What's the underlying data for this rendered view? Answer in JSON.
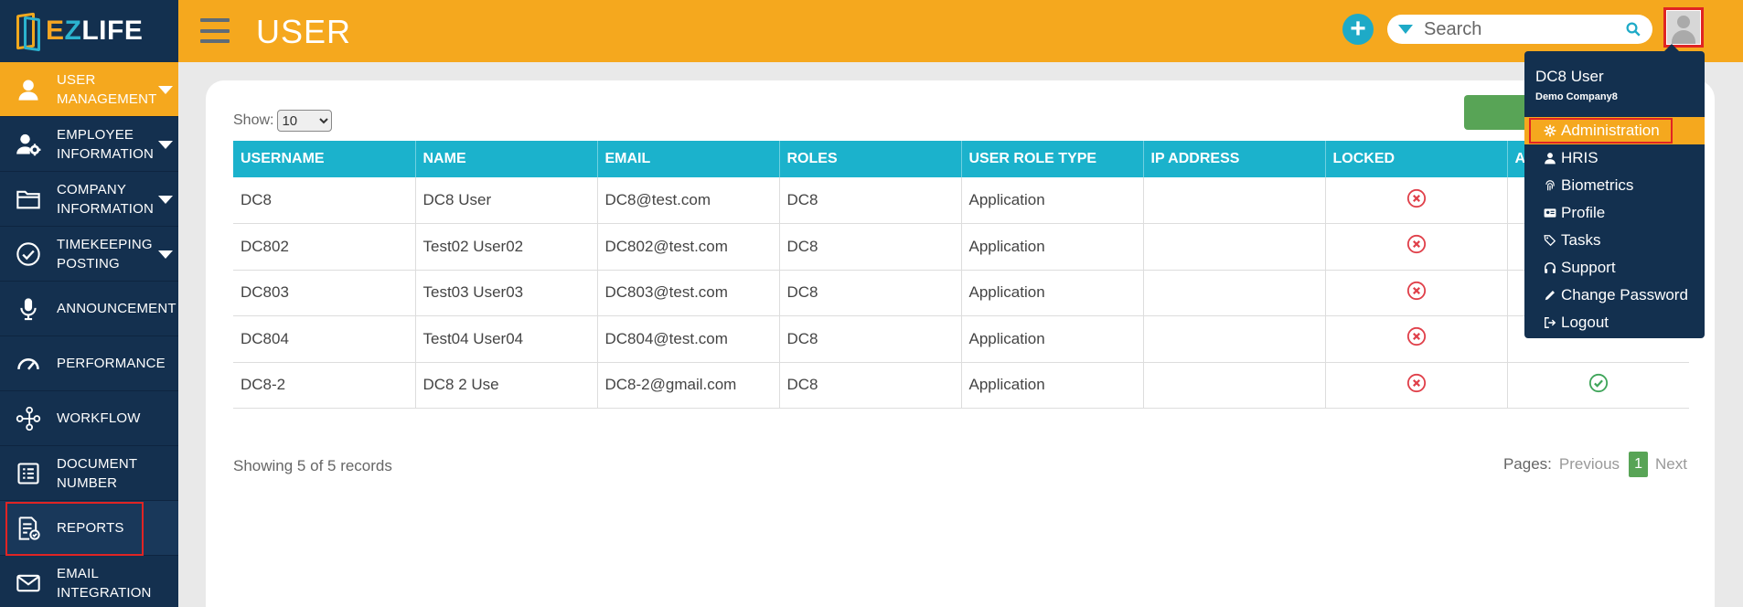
{
  "logo": {
    "letter_e": "E",
    "letter_z": "Z",
    "rest": "LIFE"
  },
  "sidebar": {
    "items": [
      {
        "label": "USER MANAGEMENT",
        "icon": "user-icon",
        "active": true,
        "caret": true
      },
      {
        "label": "EMPLOYEE INFORMATION",
        "icon": "user-gear-icon",
        "caret": true
      },
      {
        "label": "COMPANY INFORMATION",
        "icon": "folder-icon",
        "caret": true
      },
      {
        "label": "TIMEKEEPING POSTING",
        "icon": "check-circle-icon",
        "caret": true
      },
      {
        "label": "ANNOUNCEMENT",
        "icon": "microphone-icon"
      },
      {
        "label": "PERFORMANCE",
        "icon": "gauge-icon"
      },
      {
        "label": "WORKFLOW",
        "icon": "workflow-icon"
      },
      {
        "label": "DOCUMENT NUMBER",
        "icon": "list-icon"
      },
      {
        "label": "REPORTS",
        "icon": "report-icon"
      },
      {
        "label": "EMAIL INTEGRATION",
        "icon": "envelope-icon"
      }
    ]
  },
  "header": {
    "title": "USER",
    "add_label": "+",
    "search_placeholder": "Search"
  },
  "show": {
    "label": "Show:",
    "selected": "10"
  },
  "table": {
    "columns": [
      "USERNAME",
      "NAME",
      "EMAIL",
      "ROLES",
      "USER ROLE TYPE",
      "IP ADDRESS",
      "LOCKED",
      "A"
    ],
    "rows": [
      {
        "username": "DC8",
        "name": "DC8 User",
        "email": "DC8@test.com",
        "roles": "DC8",
        "role_type": "Application",
        "ip": ""
      },
      {
        "username": "DC802",
        "name": "Test02 User02",
        "email": "DC802@test.com",
        "roles": "DC8",
        "role_type": "Application",
        "ip": ""
      },
      {
        "username": "DC803",
        "name": "Test03 User03",
        "email": "DC803@test.com",
        "roles": "DC8",
        "role_type": "Application",
        "ip": ""
      },
      {
        "username": "DC804",
        "name": "Test04 User04",
        "email": "DC804@test.com",
        "roles": "DC8",
        "role_type": "Application",
        "ip": ""
      },
      {
        "username": "DC8-2",
        "name": "DC8 2 Use",
        "email": "DC8-2@gmail.com",
        "roles": "DC8",
        "role_type": "Application",
        "ip": ""
      }
    ]
  },
  "footer": {
    "records": "Showing 5 of 5 records",
    "pages_label": "Pages:",
    "previous": "Previous",
    "current_page": "1",
    "next": "Next"
  },
  "dropdown": {
    "user_name": "DC8 User",
    "company": "Demo Company8",
    "items": [
      {
        "label": "Administration",
        "icon": "gear-icon",
        "active": true
      },
      {
        "label": "HRIS",
        "icon": "person-icon"
      },
      {
        "label": "Biometrics",
        "icon": "fingerprint-icon"
      },
      {
        "label": "Profile",
        "icon": "id-card-icon"
      },
      {
        "label": "Tasks",
        "icon": "tags-icon"
      },
      {
        "label": "Support",
        "icon": "headphones-icon"
      },
      {
        "label": "Change Password",
        "icon": "pencil-icon"
      },
      {
        "label": "Logout",
        "icon": "logout-icon"
      }
    ]
  },
  "colors": {
    "accent": "#f5a81e",
    "sidebar": "#14304f",
    "table_header": "#1bb2cc",
    "locked_red": "#e0404a",
    "ok_green": "#3fa55a"
  }
}
